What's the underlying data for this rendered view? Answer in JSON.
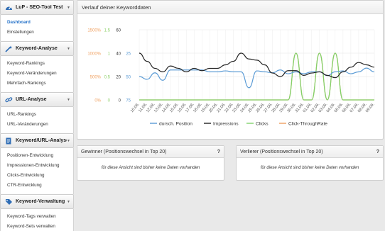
{
  "sidebar": {
    "sections": [
      {
        "title": "LuP - SEO-Tool Test",
        "icon": "dashboard-gauge-icon",
        "items": [
          "Dashboard",
          "Einstellungen"
        ],
        "active": 0
      },
      {
        "title": "Keyword-Analyse",
        "icon": "magic-wand-icon",
        "items": [
          "Keyword-Rankings",
          "Keyword-Veränderungen",
          "Mehrfach-Rankings"
        ]
      },
      {
        "title": "URL-Analyse",
        "icon": "link-icon",
        "items": [
          "URL-Rankings",
          "URL-Veränderungen"
        ]
      },
      {
        "title": "Keyword/URL-Analyse",
        "icon": "document-icon",
        "items": [
          "Positionen-Entwicklung",
          "Impressionen-Entwicklung",
          "Clicks-Entwicklung",
          "CTR-Entwicklung"
        ]
      },
      {
        "title": "Keyword-Verwaltung",
        "icon": "tag-icon",
        "items": [
          "Keyword-Tags verwalten",
          "Keyword-Sets verwalten"
        ]
      }
    ]
  },
  "chart_panel": {
    "title": "Verlauf deiner Keyworddaten"
  },
  "chart_data": {
    "type": "line",
    "x": [
      "10.08.",
      "11.08.",
      "12.08.",
      "13.08.",
      "14.08.",
      "15.08.",
      "16.08.",
      "17.08.",
      "18.08.",
      "19.08.",
      "20.08.",
      "21.08.",
      "22.08.",
      "23.08.",
      "24.08.",
      "25.08.",
      "26.08.",
      "27.08.",
      "28.08.",
      "29.08.",
      "30.08.",
      "31.08.",
      "01.09.",
      "02.09.",
      "03.09.",
      "04.09.",
      "05.09.",
      "06.09.",
      "07.09.",
      "08.09.",
      "09.09."
    ],
    "axes": [
      {
        "ticks": [
          "1500%",
          "1000%",
          "500%",
          "0%"
        ],
        "color": "#f0a060"
      },
      {
        "ticks": [
          "1.5",
          "1",
          "0.5",
          "0"
        ],
        "color": "#8ed06a"
      },
      {
        "ticks": [
          "60",
          "40",
          "20",
          "0"
        ],
        "color": "#333333"
      },
      {
        "ticks": [
          "25",
          "50",
          "75"
        ],
        "color": "#5b9bd5"
      }
    ],
    "series": [
      {
        "name": "dursch. Position",
        "color": "#5b9bd5",
        "axis": "position (25 top, 75 bottom)",
        "values": [
          50,
          53,
          46,
          54,
          43,
          43,
          43,
          43,
          43,
          45,
          45,
          44,
          45,
          45,
          62,
          44,
          45,
          46,
          43,
          47,
          45,
          47,
          45,
          45,
          49,
          45,
          44,
          47,
          45,
          41,
          45
        ]
      },
      {
        "name": "Impressions",
        "color": "#222222",
        "axis": "0-60",
        "values": [
          40,
          33,
          27,
          24,
          29,
          27,
          24,
          27,
          25,
          27,
          27,
          30,
          33,
          40,
          35,
          34,
          30,
          23,
          20,
          25,
          25,
          21,
          23,
          24,
          21,
          19,
          24,
          28,
          32,
          30,
          28
        ]
      },
      {
        "name": "Clicks",
        "color": "#7fd36b",
        "axis": "0-1.5",
        "values": [
          0,
          0,
          0,
          0,
          0,
          0,
          0,
          0,
          0,
          0,
          0,
          0,
          0,
          0,
          0,
          0,
          0,
          0,
          0,
          0,
          1,
          0,
          0,
          1,
          0,
          1,
          0,
          0,
          0,
          0,
          0
        ]
      },
      {
        "name": "Click-ThroughRate",
        "color": "#f0a060",
        "axis": "0-1500%",
        "values": [
          0,
          0,
          0,
          0,
          0,
          0,
          0,
          0,
          0,
          0,
          0,
          0,
          0,
          0,
          0,
          0,
          0,
          0,
          0,
          0,
          1000,
          0,
          0,
          1000,
          0,
          1000,
          0,
          0,
          0,
          0,
          0
        ]
      }
    ],
    "grid": true,
    "legend": "bottom"
  },
  "gewinner": {
    "title": "Gewinner (Positionswechsel in Top 20)",
    "help": "?",
    "empty": "für diese Ansicht sind bisher keine Daten vorhanden"
  },
  "verlierer": {
    "title": "Verlierer (Positionswechsel in Top 20)",
    "help": "?",
    "empty": "für diese Ansicht sind bisher keine Daten vorhanden"
  }
}
